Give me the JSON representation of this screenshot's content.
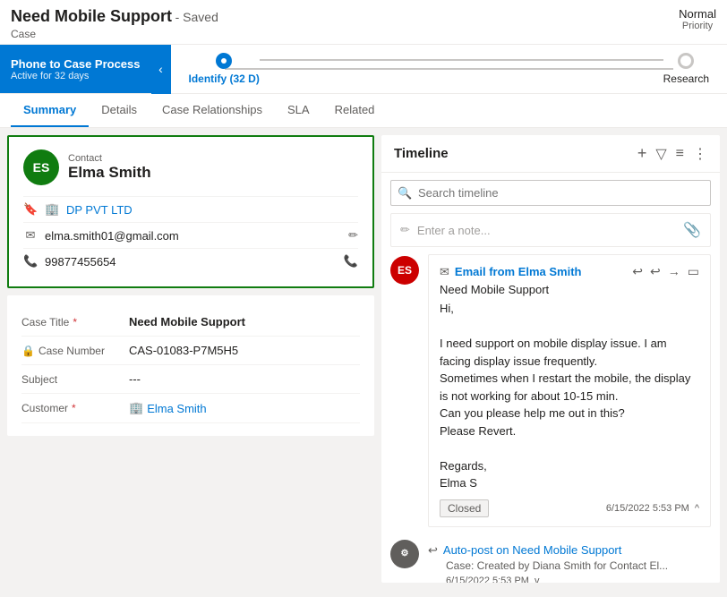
{
  "header": {
    "title": "Need Mobile Support",
    "saved_label": "- Saved",
    "case_label": "Case",
    "priority_label": "Priority",
    "priority_value": "Normal"
  },
  "process": {
    "title": "Phone to Case Process",
    "subtitle": "Active for 32 days",
    "chevron": "‹",
    "stages": [
      {
        "label": "Identify (32 D)",
        "state": "active"
      },
      {
        "label": "Research",
        "state": "inactive"
      }
    ]
  },
  "tabs": [
    {
      "label": "Summary",
      "active": true
    },
    {
      "label": "Details",
      "active": false
    },
    {
      "label": "Case Relationships",
      "active": false
    },
    {
      "label": "SLA",
      "active": false
    },
    {
      "label": "Related",
      "active": false
    }
  ],
  "contact_card": {
    "avatar_initials": "ES",
    "type_label": "Contact",
    "name": "Elma Smith",
    "company": "DP PVT LTD",
    "email": "elma.smith01@gmail.com",
    "phone": "99877455654",
    "bookmark_icon": "🔖",
    "company_icon": "🏢",
    "email_icon": "✉",
    "phone_icon": "📞",
    "edit_icon": "✏",
    "call_icon": "📞"
  },
  "form": {
    "fields": [
      {
        "label": "Case Title",
        "required": true,
        "value": "Need Mobile Support",
        "type": "bold"
      },
      {
        "label": "Case Number",
        "required": false,
        "value": "CAS-01083-P7M5H5",
        "type": "normal",
        "lock": true
      },
      {
        "label": "Subject",
        "required": false,
        "value": "---",
        "type": "normal"
      },
      {
        "label": "Customer",
        "required": true,
        "value": "Elma Smith",
        "type": "link"
      }
    ]
  },
  "timeline": {
    "title": "Timeline",
    "search_placeholder": "Search timeline",
    "note_placeholder": "Enter a note...",
    "add_icon": "+",
    "filter_icon": "▽",
    "list_icon": "≡",
    "more_icon": "⋮",
    "attach_icon": "📎",
    "entries": [
      {
        "avatar": "ES",
        "avatar_color": "#c00",
        "icon": "✉",
        "title": "Email from Elma Smith",
        "subject": "Need Mobile Support",
        "greeting": "Hi,",
        "body": "I need support on mobile display issue. I am facing display issue frequently.\nSometimes when I restart the mobile, the display is not working for about 10-15 min.\nCan you please help me out in this?\nPlease Revert.\n\nRegards,\nElma S",
        "status": "Closed",
        "time": "6/15/2022 5:53 PM",
        "reply_icon": "↩",
        "reply_all_icon": "↩",
        "forward_icon": "→",
        "more_icon": "▭",
        "chevron_up": "^"
      },
      {
        "avatar": "G",
        "avatar_color": "#605e5c",
        "icon": "↩",
        "title": "Auto-post on Need Mobile Support",
        "subject": "Case: Created by Diana Smith for Contact El...",
        "time": "6/15/2022 5:53 PM",
        "chevron_down": "v"
      }
    ]
  }
}
